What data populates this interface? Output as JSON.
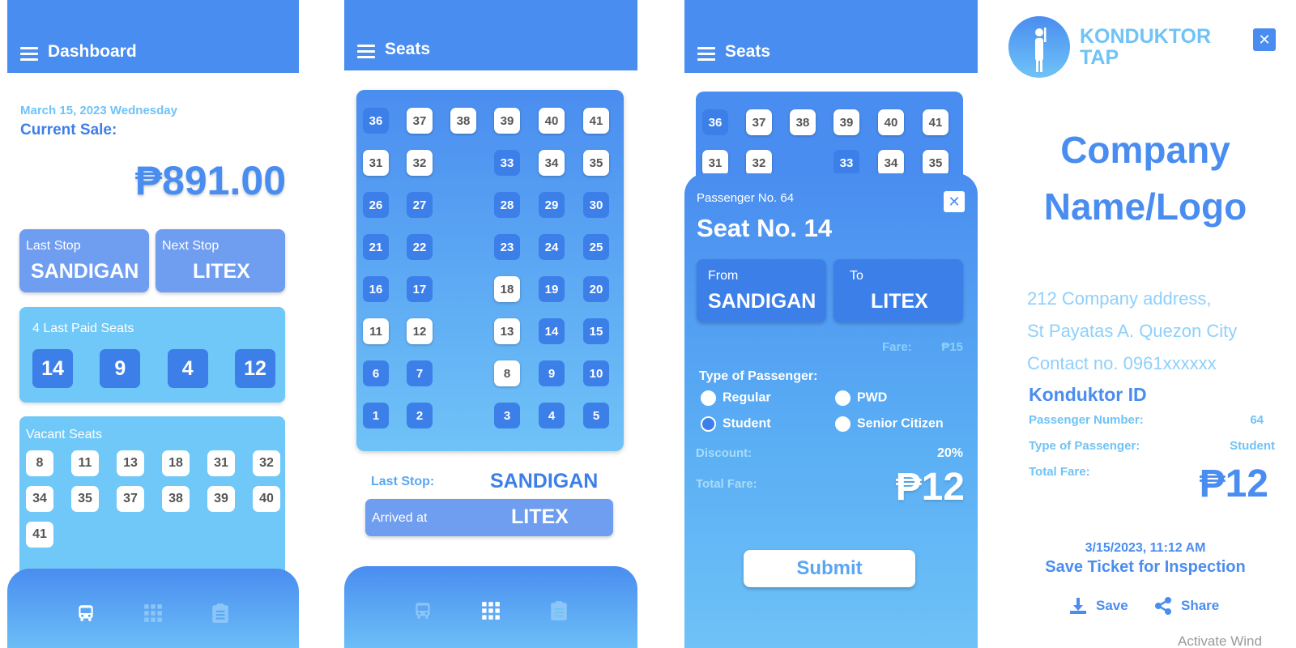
{
  "dashboard": {
    "title": "Dashboard",
    "date": "March 15, 2023 Wednesday",
    "current_sale_label": "Current Sale:",
    "current_sale": "₱891.00",
    "last_stop_label": "Last Stop",
    "last_stop": "SANDIGAN",
    "next_stop_label": "Next Stop",
    "next_stop": "LITEX",
    "paid_label": "4 Last Paid Seats",
    "paid_seats": [
      "14",
      "9",
      "4",
      "12"
    ],
    "vacant_label": "Vacant Seats",
    "vacant_seats": [
      "8",
      "11",
      "13",
      "18",
      "31",
      "32",
      "34",
      "35",
      "37",
      "38",
      "39",
      "40",
      "41"
    ]
  },
  "seats": {
    "title": "Seats",
    "rows": [
      [
        "36",
        "37",
        "38",
        "39",
        "40",
        "41"
      ],
      [
        "31",
        "32",
        "",
        "33",
        "34",
        "35"
      ],
      [
        "26",
        "27",
        "",
        "28",
        "29",
        "30"
      ],
      [
        "21",
        "22",
        "",
        "23",
        "24",
        "25"
      ],
      [
        "16",
        "17",
        "",
        "18",
        "19",
        "20"
      ],
      [
        "11",
        "12",
        "",
        "13",
        "14",
        "15"
      ],
      [
        "6",
        "7",
        "",
        "8",
        "9",
        "10"
      ],
      [
        "1",
        "2",
        "",
        "3",
        "4",
        "5"
      ]
    ],
    "vacant": [
      "37",
      "38",
      "39",
      "40",
      "41",
      "31",
      "32",
      "34",
      "35",
      "18",
      "11",
      "12",
      "13",
      "8"
    ],
    "last_stop_label": "Last Stop:",
    "last_stop": "SANDIGAN",
    "arrived_label": "Arrived at",
    "arrived": "LITEX"
  },
  "modal": {
    "title": "Seats",
    "passenger_no": "Passenger No. 64",
    "seat_no": "Seat No. 14",
    "from_label": "From",
    "from": "SANDIGAN",
    "to_label": "To",
    "to": "LITEX",
    "fare_label": "Fare:",
    "fare": "₱15",
    "type_label": "Type of Passenger:",
    "types": [
      "Regular",
      "PWD",
      "Student",
      "Senior Citizen"
    ],
    "selected_type": "Student",
    "discount_label": "Discount:",
    "discount": "20%",
    "total_label": "Total Fare:",
    "total": "₱12",
    "submit": "Submit",
    "bg_rows": [
      [
        "36",
        "37",
        "38",
        "39",
        "40",
        "41"
      ],
      [
        "31",
        "32",
        "",
        "33",
        "34",
        "35"
      ]
    ]
  },
  "ticket": {
    "brand_line1": "KONDUKTOR",
    "brand_line2": "TAP",
    "company_line1": "Company",
    "company_line2": "Name/Logo",
    "address1": "212 Company address,",
    "address2": "St Payatas A. Quezon City",
    "contact": "Contact no. 0961xxxxxx",
    "id_label": "Konduktor ID",
    "passenger_number_label": "Passenger Number:",
    "passenger_number": "64",
    "type_label": "Type of Passenger:",
    "type": "Student",
    "total_label": "Total Fare:",
    "total": "₱12",
    "datetime": "3/15/2023, 11:12 AM",
    "save_ticket": "Save Ticket for Inspection",
    "save": "Save",
    "share": "Share",
    "watermark": "Activate Wind"
  },
  "colors": {
    "primary": "#4a8df0",
    "light": "#6fc3f7",
    "seat_blue": "#3d7fe8",
    "white": "#ffffff"
  }
}
